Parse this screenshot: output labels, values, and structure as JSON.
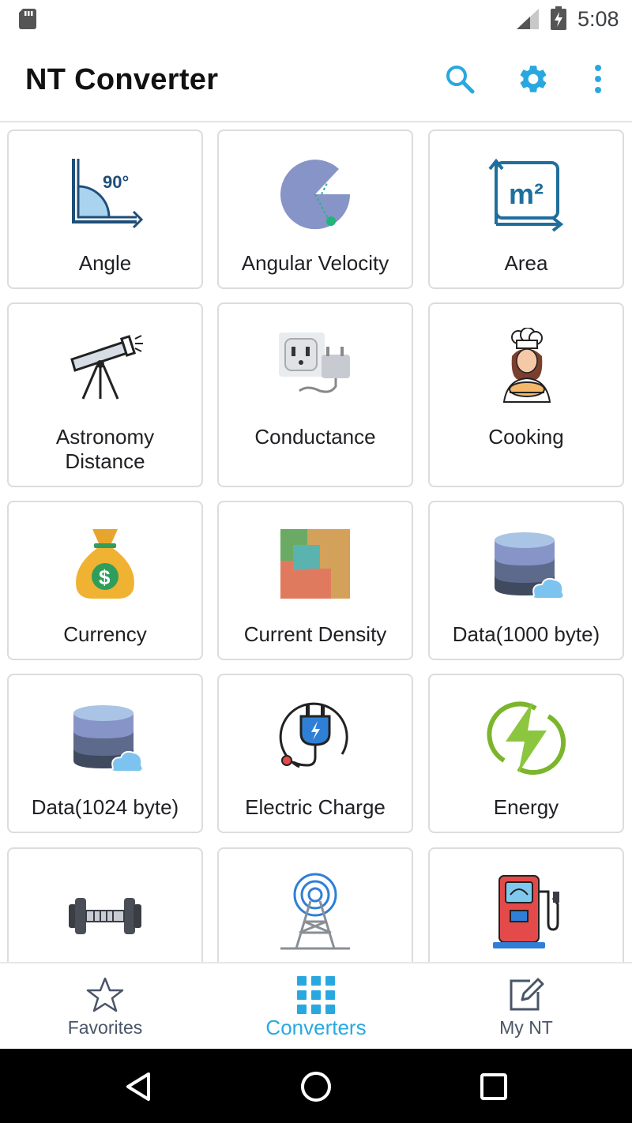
{
  "status_bar": {
    "time": "5:08",
    "icons": [
      "sd-card-icon",
      "signal-icon",
      "battery-charging-icon"
    ]
  },
  "app_bar": {
    "title": "NT Converter",
    "actions": [
      "search-icon",
      "gear-icon",
      "more-vert-icon"
    ]
  },
  "converters": [
    {
      "label": "Angle",
      "icon": "angle-icon"
    },
    {
      "label": "Angular Velocity",
      "icon": "angular-velocity-icon"
    },
    {
      "label": "Area",
      "icon": "area-icon"
    },
    {
      "label_line1": "Astronomy",
      "label_line2": "Distance",
      "icon": "telescope-icon"
    },
    {
      "label": "Conductance",
      "icon": "power-outlet-icon"
    },
    {
      "label": "Cooking",
      "icon": "chef-icon"
    },
    {
      "label": "Currency",
      "icon": "money-bag-icon"
    },
    {
      "label": "Current Density",
      "icon": "current-density-icon"
    },
    {
      "label": "Data(1000 byte)",
      "icon": "database-cloud-icon"
    },
    {
      "label": "Data(1024 byte)",
      "icon": "database-cloud-icon"
    },
    {
      "label": "Electric Charge",
      "icon": "plug-icon"
    },
    {
      "label": "Energy",
      "icon": "energy-bolt-icon"
    },
    {
      "icon": "dumbbell-icon"
    },
    {
      "icon": "radio-tower-icon"
    },
    {
      "icon": "fuel-pump-icon"
    }
  ],
  "bottom_nav": {
    "items": [
      {
        "label": "Favorites",
        "icon": "star-icon"
      },
      {
        "label": "Converters",
        "icon": "grid-icon",
        "selected": true
      },
      {
        "label": "My NT",
        "icon": "edit-icon"
      }
    ],
    "active_color": "#29a8e0"
  },
  "system_nav": [
    "back-icon",
    "home-icon",
    "recents-icon"
  ]
}
